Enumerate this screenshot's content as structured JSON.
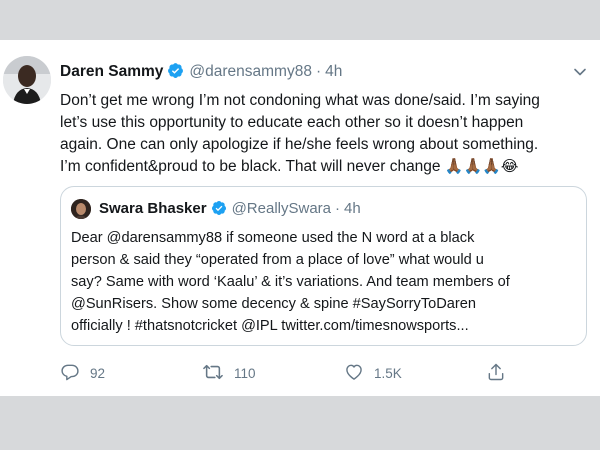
{
  "tweet": {
    "author_name": "Daren Sammy",
    "author_handle": "@darensammy88",
    "separator": "·",
    "time": "4h",
    "lines": [
      "Don’t get me wrong I’m not condoning what was done/said. I’m saying",
      "let’s use this opportunity to educate each other so it doesn’t happen",
      "again. One can only apologize if he/she feels wrong about something.",
      "I’m confident&proud to be black. That will never change "
    ],
    "emojis": "🙏🏾🙏🏾🙏🏾😂"
  },
  "quoted_tweet": {
    "author_name": "Swara Bhasker",
    "author_handle": "@ReallySwara",
    "separator": "·",
    "time": "4h",
    "lines": [
      "Dear @darensammy88 if someone used the N word at a black",
      "person & said they “operated from a place of love” what would u",
      "say? Same with word ‘Kaalu’ & it’s variations. And team members of",
      "@SunRisers. Show some decency & spine #SaySorryToDaren",
      "officially ! #thatsnotcricket @IPL twitter.com/timesnowsports..."
    ]
  },
  "actions": {
    "reply_count": "92",
    "retweet_count": "110",
    "like_count": "1.5K"
  },
  "colors": {
    "verified": "#1da1f2",
    "secondary_text": "#657786",
    "primary_text": "#14171a",
    "border": "#ccd6dd"
  },
  "icons": [
    "verified-badge-icon",
    "chevron-down-icon",
    "reply-icon",
    "retweet-icon",
    "like-icon",
    "share-icon"
  ]
}
